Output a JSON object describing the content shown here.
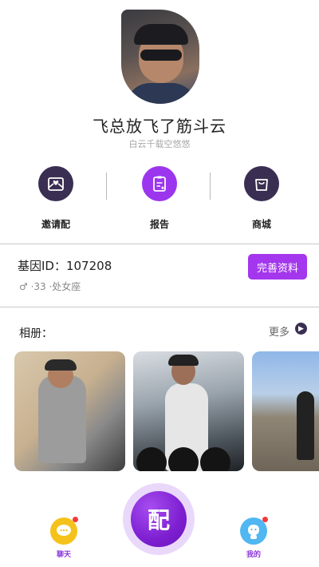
{
  "profile": {
    "username": "飞总放飞了筋斗云",
    "signature": "白云千载空悠悠"
  },
  "actions": [
    {
      "label": "邀请配",
      "icon": "heart-envelope-icon"
    },
    {
      "label": "报告",
      "icon": "report-clipboard-icon"
    },
    {
      "label": "商城",
      "icon": "shopping-bag-icon"
    }
  ],
  "gene": {
    "id_text": "基因ID：107208",
    "meta": "♂ ·33 ·处女座",
    "complete_button": "完善资料"
  },
  "album": {
    "title": "相册：",
    "more_label": "更多",
    "photos": [
      {
        "icon": "photo-man-lounging"
      },
      {
        "icon": "photo-man-gym"
      },
      {
        "icon": "photo-man-mountains"
      }
    ]
  },
  "bottom_nav": {
    "chat_label": "聊天",
    "center_glyph": "配",
    "me_label": "我的"
  },
  "colors": {
    "accent_purple": "#9b36ee",
    "dark_circle": "#3a2f52",
    "chat_yellow": "#f5c21b",
    "me_blue": "#50b7f2",
    "badge_red": "#f23a3a"
  }
}
